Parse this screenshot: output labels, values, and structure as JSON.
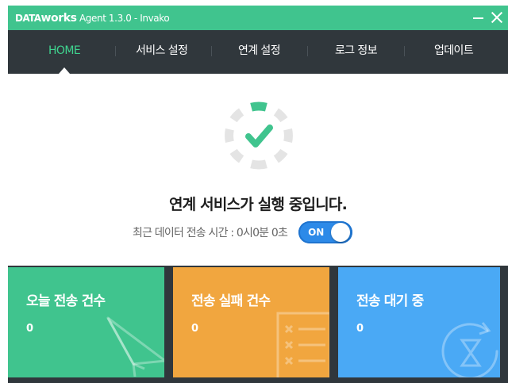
{
  "window": {
    "title_brand_upper": "DATA",
    "title_brand_lower": "works",
    "title_rest": " Agent 1.3.0 - Invako",
    "controls": [
      "minimize-icon",
      "close-icon"
    ]
  },
  "nav": {
    "tabs": [
      {
        "label": "HOME",
        "active": true
      },
      {
        "label": "서비스 설정",
        "active": false
      },
      {
        "label": "연계 설정",
        "active": false
      },
      {
        "label": "로그 정보",
        "active": false
      },
      {
        "label": "업데이트",
        "active": false
      }
    ]
  },
  "status": {
    "icon": "check-spinner-icon",
    "heading": "연계 서비스가 실행 중입니다.",
    "last_transfer_label": "최근 데이터 전송 시간 : 0시0분 0초",
    "toggle_label": "ON",
    "toggle_on": true
  },
  "cards": [
    {
      "title": "오늘 전송 건수",
      "value": "0",
      "icon": "paper-plane-icon",
      "color": "#40c48e"
    },
    {
      "title": "전송 실패 건수",
      "value": "0",
      "icon": "failed-list-icon",
      "color": "#f1a63f"
    },
    {
      "title": "전송 대기 중",
      "value": "0",
      "icon": "hourglass-refresh-icon",
      "color": "#4aa9f5"
    }
  ],
  "colors": {
    "accent_green": "#40c48e",
    "active_tab": "#3fd48f",
    "dark_bg": "#30373c",
    "toggle_blue": "#2d8ae8"
  }
}
